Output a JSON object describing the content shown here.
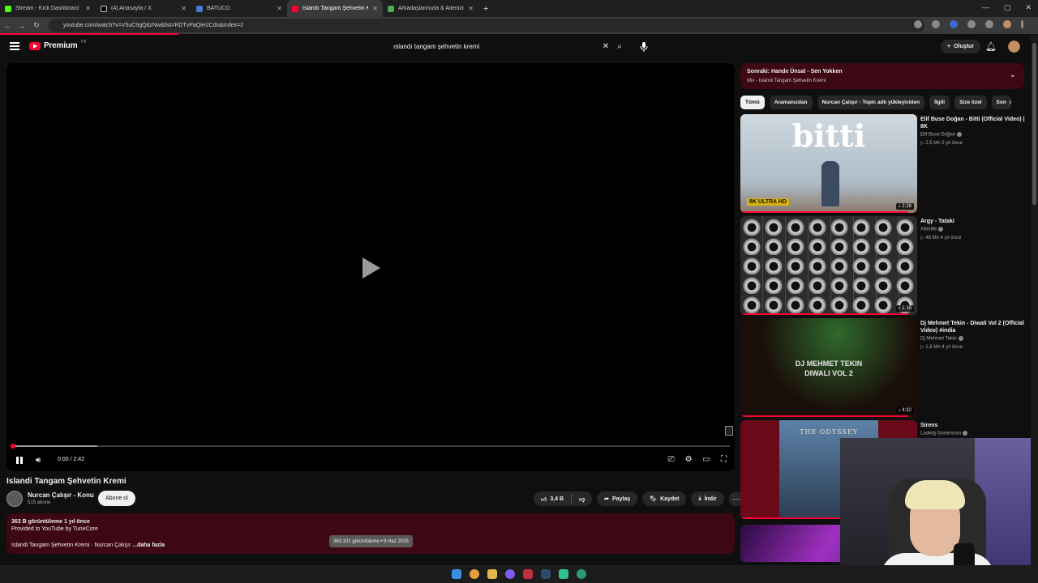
{
  "browser": {
    "tabs": [
      {
        "title": "Stream - Kick Dashboard",
        "color": "#53fc18"
      },
      {
        "title": "(4) Anasayfa / X",
        "color": "#ffffff"
      },
      {
        "title": "BATUCO",
        "color": "#4a7bd0"
      },
      {
        "title": "Islandı Tangam Şehvetin Kremi",
        "color": "#ff0033"
      },
      {
        "title": "Arkadaşlarınızla & Ailenizle Ücr",
        "color": "#4caf50"
      }
    ],
    "url": "youtube.com/watch?v=V5uC9gQdzNw&list=RDTvPaQiH2Cdo&index=2"
  },
  "header": {
    "logo": "Premium",
    "region": "TR",
    "search_query": "ıslandı tangam şehvetin kremi",
    "create_label": "Oluştur"
  },
  "player": {
    "time": "0:00 / 2:42",
    "progress_buffered": 0.12
  },
  "video": {
    "title": "Islandi Tangam Şehvetin Kremi",
    "channel": "Nurcan Çalışır - Konu",
    "subscribers": "515 abone",
    "subscribe_label": "Abone ol",
    "likes": "3,4 B",
    "share_label": "Paylaş",
    "save_label": "Kaydet",
    "download_label": "İndir",
    "views_line": "363 B görüntüleme  1 yıl önce",
    "provided_by": "Provided to YouTube by TuneCore",
    "desc_line": "Islandi Tangam Şehvetin Kremi · Nurcan Çalışır",
    "more_label": "...daha fazla",
    "tooltip": "363.101 görüntüleme • 9 Haz 2025"
  },
  "up_next": {
    "title": "Sonraki: Hande Ünsal - Sen Yokken",
    "subtitle": "Mix - Islandi Tangam Şehvetin Kremi"
  },
  "chips": [
    "Tümü",
    "Aramanızdan",
    "Nurcan Çalışır - Topic adlı yükleyiciden",
    "İlgili",
    "Size özel",
    "Son"
  ],
  "recommendations": [
    {
      "title": "Elif Buse Doğan - Bitti (Official Video) | 8K",
      "channel": "Elif Buse Doğan",
      "meta": "▷ 2,5 Mn   2 yıl önce",
      "duration": "♪ 2:28",
      "thumb_text": "bitti",
      "badge": "8K ULTRA HD",
      "progress": 0.95
    },
    {
      "title": "Argy - Tataki",
      "channel": "Afterlife",
      "meta": "▷ 48 Mn   4 yıl önce",
      "duration": "♪ 5:30",
      "progress": 0.95
    },
    {
      "title": "Dj Mehmet Tekin - Diwali Vol 2 (Official Video) #india",
      "channel": "Dj Mehmet Tekin",
      "meta": "▷ 1,8 Mn   4 yıl önce",
      "duration": "♪ 4:32",
      "thumb_text": "DJ MEHMET TEKIN\nDIWALI VOL 2",
      "progress": 0.95
    },
    {
      "title": "Sirens",
      "channel": "Ludwig Goransson",
      "thumb_text": "THE ODYSSEY",
      "progress": 0.95
    }
  ]
}
